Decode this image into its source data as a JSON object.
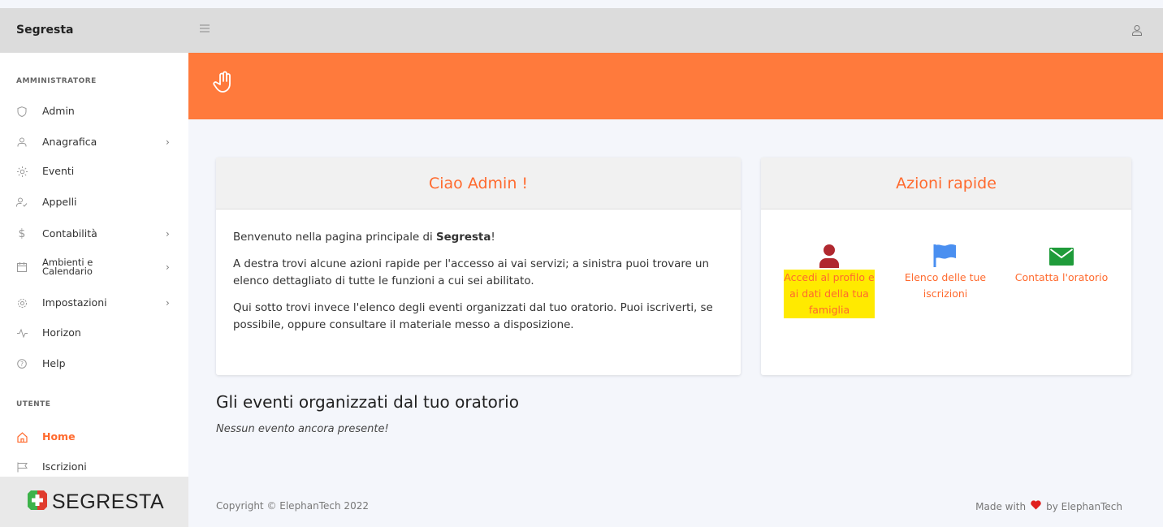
{
  "app": {
    "brand": "Segresta"
  },
  "sidebar": {
    "sections": [
      {
        "title": "AMMINISTRATORE"
      },
      {
        "title": "UTENTE"
      }
    ],
    "admin_items": [
      {
        "label": "Admin",
        "icon": "shield-icon",
        "has_submenu": false
      },
      {
        "label": "Anagrafica",
        "icon": "user-icon",
        "has_submenu": true
      },
      {
        "label": "Eventi",
        "icon": "sun-icon",
        "has_submenu": false
      },
      {
        "label": "Appelli",
        "icon": "user-check-icon",
        "has_submenu": false
      },
      {
        "label": "Contabilità",
        "icon": "dollar-icon",
        "has_submenu": true
      },
      {
        "label": "Ambienti e Calendario",
        "label_line1": "Ambienti e",
        "label_line2": "Calendario",
        "icon": "calendar-icon",
        "has_submenu": true
      },
      {
        "label": "Impostazioni",
        "icon": "gear-icon",
        "has_submenu": true
      },
      {
        "label": "Horizon",
        "icon": "activity-icon",
        "has_submenu": false
      },
      {
        "label": "Help",
        "icon": "help-icon",
        "has_submenu": false
      }
    ],
    "user_items": [
      {
        "label": "Home",
        "icon": "home-icon",
        "active": true
      },
      {
        "label": "Iscrizioni",
        "icon": "flag-icon",
        "active": false
      }
    ],
    "chevron": "›",
    "logo_text": "SEGRESTA"
  },
  "welcome": {
    "title": "Ciao Admin !",
    "p1_prefix": "Benvenuto nella pagina principale di ",
    "p1_bold": "Segresta",
    "p1_suffix": "!",
    "p2": "A destra trovi alcune azioni rapide per l'accesso ai vai servizi; a sinistra puoi trovare un elenco dettagliato di tutte le funzioni a cui sei abilitato.",
    "p3": "Qui sotto trovi invece l'elenco degli eventi organizzati dal tuo oratorio. Puoi iscriverti, se possibile, oppure consultare il materiale messo a disposizione."
  },
  "quick_actions": {
    "title": "Azioni rapide",
    "items": [
      {
        "label_lines": [
          "Accedi al profilo e",
          "ai dati della tua",
          "famiglia"
        ],
        "icon": "user-icon",
        "icon_color": "#b0282f",
        "highlighted": true
      },
      {
        "label_lines": [
          "Elenco delle tue",
          "iscrizioni"
        ],
        "icon": "flag-icon",
        "icon_color": "#4a8ff0",
        "highlighted": false
      },
      {
        "label_lines": [
          "Contatta l'oratorio"
        ],
        "icon": "envelope-icon",
        "icon_color": "#1f9b3a",
        "highlighted": false
      }
    ]
  },
  "events": {
    "title": "Gli eventi organizzati dal tuo oratorio",
    "empty": "Nessun evento ancora presente!"
  },
  "footer": {
    "copyright": "Copyright © ElephanTech 2022",
    "made_with": "Made with",
    "by": "by ElephanTech"
  },
  "colors": {
    "accent": "#ff6a2e",
    "banner": "#ff7a3c",
    "highlight": "#ffea00",
    "heart": "#e0201f"
  }
}
